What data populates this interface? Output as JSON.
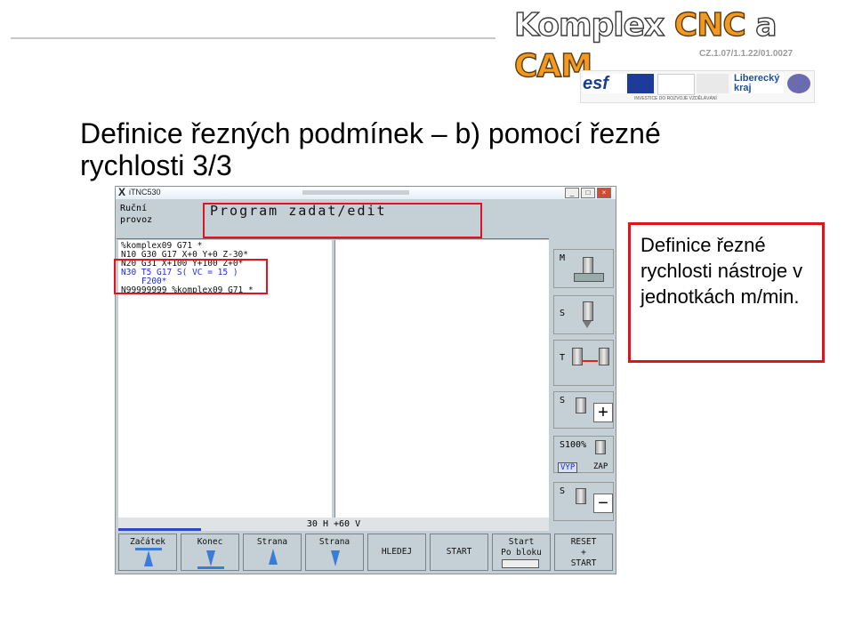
{
  "header": {
    "logo_part1": "Komplex ",
    "logo_part2": "CNC",
    "logo_part3": " a ",
    "logo_part4": "CAM",
    "project_code": "CZ.1.07/1.1.22/01.0027",
    "partners_note": "INVESTICE DO ROZVOJE VZDĚLÁVÁNÍ",
    "kraj_label": "Liberecký kraj",
    "esf_label": "esf"
  },
  "title": "Definice řezných podmínek – b) pomocí řezné rychlosti 3/3",
  "window": {
    "app_name": "iTNC530",
    "mode_line1": "Ruční",
    "mode_line2": "provoz",
    "edit_title": "Program zadat/edit",
    "program_lines": [
      "%komplex09 G71 *",
      "N10 G30 G17 X+0 Y+0 Z-30*",
      "N20 G31 X+100 Y+100 Z+0*",
      "N30 T5 G17 S( VC = 15 )",
      "    F200*",
      "N99999999 %komplex09 G71 *"
    ],
    "status_text": "30 H +60 V",
    "side_softkeys": {
      "m_label": "M",
      "s_label": "S",
      "t_label": "T",
      "s_plus_label": "S",
      "s100_label": "S100%",
      "vyp_label": "VYP",
      "zap_label": "ZAP",
      "s_minus_label": "S"
    },
    "softkeys": [
      "Začátek",
      "Konec",
      "Strana",
      "Strana",
      "HLEDEJ",
      "START",
      "Start",
      "Po bloku",
      "RESET",
      "+",
      "START"
    ]
  },
  "callout": {
    "text": "Definice řezné rychlosti nástroje v jednotkách m/min."
  },
  "colors": {
    "highlight": "#e0141c",
    "logo_orange": "#f29a1f",
    "program_highlight": "#1d2ed8"
  }
}
